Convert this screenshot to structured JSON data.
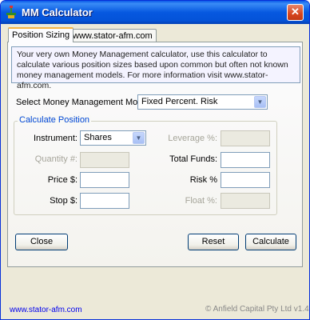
{
  "window": {
    "title": "MM Calculator",
    "close_glyph": "✕",
    "icon": "app-icon",
    "colors": {
      "titlebar": "#0658e0",
      "group_title": "#0046d5"
    }
  },
  "tabs": [
    {
      "label": "Position Sizing",
      "active": true
    },
    {
      "label": "www.stator-afm.com",
      "active": false
    }
  ],
  "info_text": "Your very own Money Management calculator, use this calculator to calculate various position sizes based upon common but often not known money management models. For more information visit www.stator-afm.com.",
  "model": {
    "label": "Select Money Management Model:",
    "value": "Fixed Percent. Risk"
  },
  "group": {
    "title": "Calculate Position",
    "instrument_label": "Instrument:",
    "instrument_value": "Shares",
    "quantity_label": "Quantity #:",
    "price_label": "Price $:",
    "stop_label": "Stop $:",
    "leverage_label": "Leverage %:",
    "total_funds_label": "Total Funds:",
    "risk_label": "Risk %",
    "float_label": "Float %:"
  },
  "buttons": {
    "close": "Close",
    "reset": "Reset",
    "calculate": "Calculate"
  },
  "footer": {
    "link": "www.stator-afm.com",
    "copyright": "© Anfield Capital Pty Ltd v1.4"
  }
}
